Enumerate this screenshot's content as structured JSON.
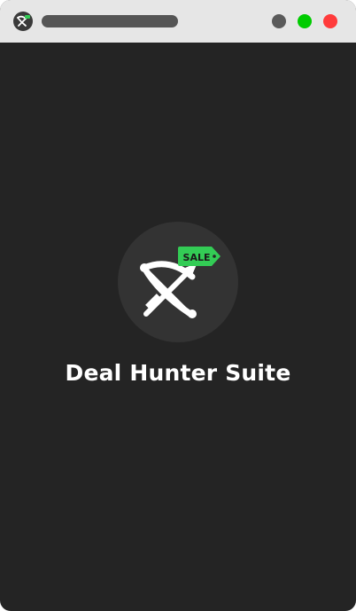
{
  "titlebar": {
    "app_icon": "bow-and-arrow-icon",
    "controls": {
      "minimize_color": "#5a5a5a",
      "maximize_color": "#00cc00",
      "close_color": "#ff3b3b"
    }
  },
  "splash": {
    "logo_icon": "bow-and-arrow-icon",
    "tag_text": "SALE",
    "tag_color": "#33cc55",
    "app_name": "Deal Hunter Suite"
  },
  "colors": {
    "background": "#242424",
    "titlebar": "#e6e6e6",
    "logo_circle": "#333333",
    "text": "#ffffff"
  }
}
